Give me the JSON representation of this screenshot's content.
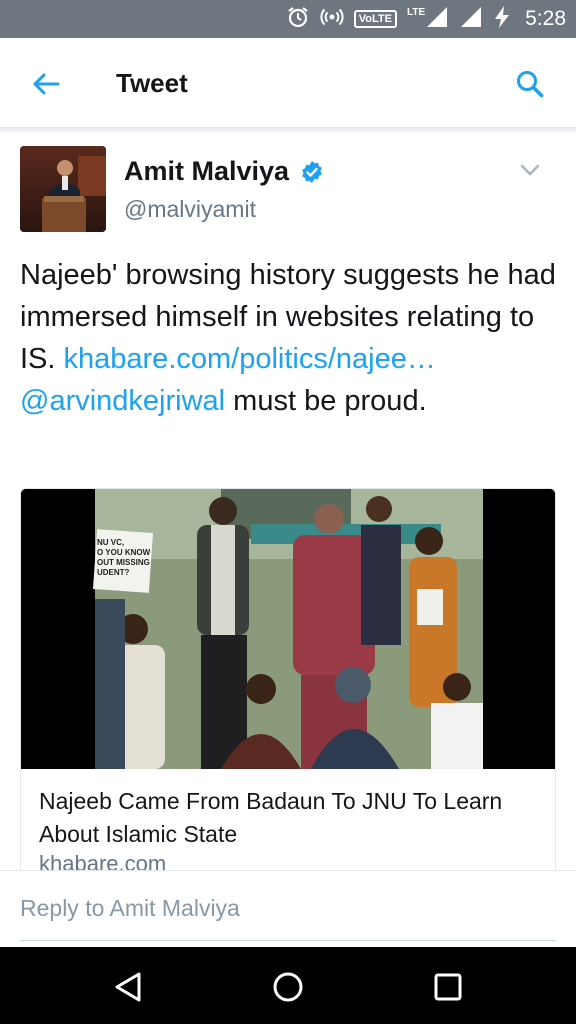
{
  "status_bar": {
    "time": "5:28",
    "volte_label": "VoLTE",
    "lte_label": "LTE",
    "icons": [
      "alarm-icon",
      "hotspot-icon",
      "volte-icon",
      "signal-icon",
      "signal-icon",
      "charging-icon"
    ]
  },
  "app_bar": {
    "title": "Tweet",
    "back_icon": "arrow-left-icon",
    "search_icon": "search-icon"
  },
  "tweet": {
    "author_name": "Amit Malviya",
    "author_handle": "@malviyamit",
    "text_part1": "Najeeb' browsing history suggests he had immersed himself in websites relating to IS. ",
    "link": "khabare.com/politics/najee…",
    "text_space": " ",
    "mention": "@arvindkejriwal",
    "text_part2": " must be proud.",
    "link_color": "#1da1f2"
  },
  "card": {
    "sign_text": "NU VC, O YOU KNOW OUT MISSING UDENT?",
    "title": "Najeeb Came From Badaun To JNU To Learn About Islamic State",
    "domain": "khabare.com"
  },
  "reply": {
    "placeholder": "Reply to Amit Malviya"
  },
  "colors": {
    "accent": "#1da1f2",
    "status_bar": "#6e7780",
    "nav_bar": "#000000"
  }
}
